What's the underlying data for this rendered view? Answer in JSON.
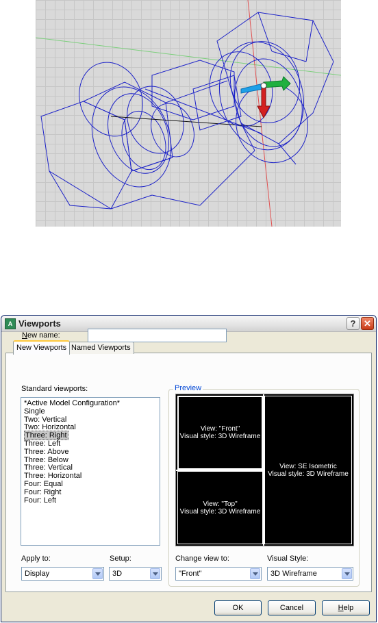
{
  "dialog": {
    "title": "Viewports",
    "help_glyph": "?",
    "close_glyph": "✕",
    "tabs": [
      {
        "label": "New Viewports",
        "active": true
      },
      {
        "label": "Named Viewports",
        "active": false
      }
    ],
    "new_name": {
      "label": "New name:",
      "value": ""
    },
    "standard_viewports": {
      "label": "Standard viewports:",
      "items": [
        "*Active Model Configuration*",
        "Single",
        "Two:  Vertical",
        "Two:  Horizontal",
        "Three: Right",
        "Three: Left",
        "Three: Above",
        "Three: Below",
        "Three: Vertical",
        "Three: Horizontal",
        "Four:  Equal",
        "Four:  Right",
        "Four:  Left"
      ],
      "selected_index": 4
    },
    "preview": {
      "legend": "Preview",
      "front": {
        "line1": "View: \"Front\"",
        "line2": "Visual style: 3D Wireframe"
      },
      "top": {
        "line1": "View: \"Top\"",
        "line2": "Visual style: 3D Wireframe"
      },
      "iso": {
        "line1": "View: SE Isometric",
        "line2": "Visual style: 3D Wireframe"
      }
    },
    "apply_to": {
      "label": "Apply to:",
      "value": "Display"
    },
    "setup": {
      "label": "Setup:",
      "value": "3D"
    },
    "change_view_to": {
      "label": "Change view to:",
      "value": "\"Front\""
    },
    "visual_style": {
      "label": "Visual Style:",
      "value": "3D Wireframe"
    },
    "buttons": {
      "ok": "OK",
      "cancel": "Cancel",
      "help": "Help"
    }
  },
  "colors": {
    "wireframe": "#1c22c8",
    "ucs_x": "#1ea0e8",
    "ucs_y": "#20b040",
    "ucs_z": "#d42020",
    "grid_bg": "#d9d9d9",
    "dialog_bg": "#ece9d8"
  }
}
